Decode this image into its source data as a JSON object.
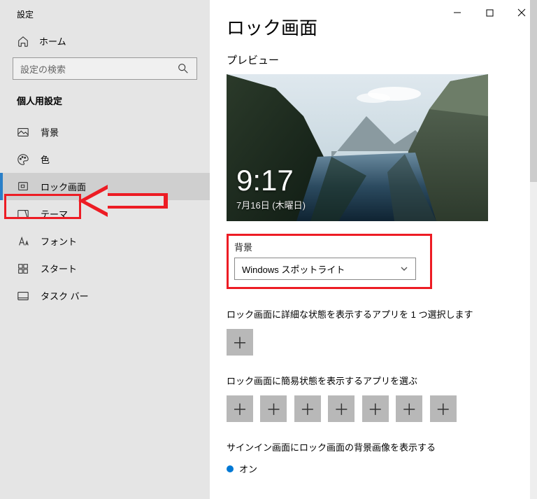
{
  "app": {
    "title": "設定"
  },
  "titlebar": {
    "minimize": "−",
    "maximize": "□",
    "close": "×"
  },
  "sidebar": {
    "home": "ホーム",
    "search_placeholder": "設定の検索",
    "section": "個人用設定",
    "items": [
      {
        "label": "背景",
        "icon": "image-icon"
      },
      {
        "label": "色",
        "icon": "palette-icon"
      },
      {
        "label": "ロック画面",
        "icon": "lockscreen-icon",
        "selected": true
      },
      {
        "label": "テーマ",
        "icon": "theme-icon"
      },
      {
        "label": "フォント",
        "icon": "font-icon"
      },
      {
        "label": "スタート",
        "icon": "start-icon"
      },
      {
        "label": "タスク バー",
        "icon": "taskbar-icon"
      }
    ]
  },
  "page": {
    "title": "ロック画面",
    "preview_label": "プレビュー",
    "preview_time": "9:17",
    "preview_date": "7月16日 (木曜日)",
    "bg_label": "背景",
    "bg_value": "Windows スポットライト",
    "detailed_apps": "ロック画面に詳細な状態を表示するアプリを 1 つ選択します",
    "quick_apps": "ロック画面に簡易状態を表示するアプリを選ぶ",
    "signin_label": "サインイン画面にロック画面の背景画像を表示する",
    "toggle_on": "オン"
  },
  "annotations": {
    "highlight_nav": true,
    "highlight_dropdown": true
  }
}
